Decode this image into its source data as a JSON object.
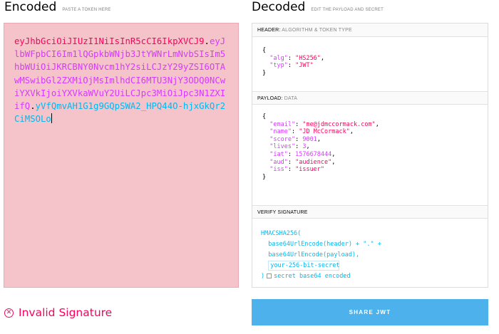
{
  "encoded": {
    "title": "Encoded",
    "subtitle": "PASTE A TOKEN HERE",
    "token_header": "eyJhbGciOiJIUzI1NiIsInR5cCI6IkpXVCJ9",
    "token_payload": "eyJlbWFpbCI6Im1lQGpkbWNjb3JtYWNrLmNvbSIsIm5hbWUiOiJKRCBNY0Nvcm1hY2siLCJzY29yZSI6OTAwMSwibGl2ZXMiOjMsImlhdCI6MTU3NjY3ODQ0NCwiYXVkIjoiYXVkaWVuY2UiLCJpc3MiOiJpc3N1ZXIifQ",
    "token_signature": "yVfQmvAH1G1g9GQpSWA2_HPQ44O-hjxGkQr2CiMSOLo"
  },
  "decoded": {
    "title": "Decoded",
    "subtitle": "EDIT THE PAYLOAD AND SECRET",
    "header_section": {
      "label": "HEADER:",
      "sub": "ALGORITHM & TOKEN TYPE"
    },
    "header_json": {
      "alg_key": "\"alg\"",
      "alg_val": "\"HS256\"",
      "typ_key": "\"typ\"",
      "typ_val": "\"JWT\""
    },
    "payload_section": {
      "label": "PAYLOAD:",
      "sub": "DATA"
    },
    "payload_json": {
      "email_key": "\"email\"",
      "email_val": "\"me@jdmccormack.com\"",
      "name_key": "\"name\"",
      "name_val": "\"JD McCormack\"",
      "score_key": "\"score\"",
      "score_val": "9001",
      "lives_key": "\"lives\"",
      "lives_val": "3",
      "iat_key": "\"iat\"",
      "iat_val": "1576678444",
      "aud_key": "\"aud\"",
      "aud_val": "\"audience\"",
      "iss_key": "\"iss\"",
      "iss_val": "\"issuer\""
    },
    "verify_section": {
      "label": "VERIFY SIGNATURE"
    },
    "verify": {
      "line1": "HMACSHA256(",
      "line2": "  base64UrlEncode(header) + \".\" +",
      "line3": "  base64UrlEncode(payload),",
      "secret_value": "your-256-bit-secret",
      "close_paren": ")",
      "checkbox_label": "secret base64 encoded"
    }
  },
  "status": {
    "invalid_text": "Invalid Signature",
    "icon": "x-circle-icon"
  },
  "share_button": {
    "label": "SHARE JWT"
  },
  "colors": {
    "header": "#fb015b",
    "payload": "#d63aff",
    "signature": "#00b9f1",
    "invalid_bg": "#f5c3ca",
    "button": "#4db1ec"
  }
}
